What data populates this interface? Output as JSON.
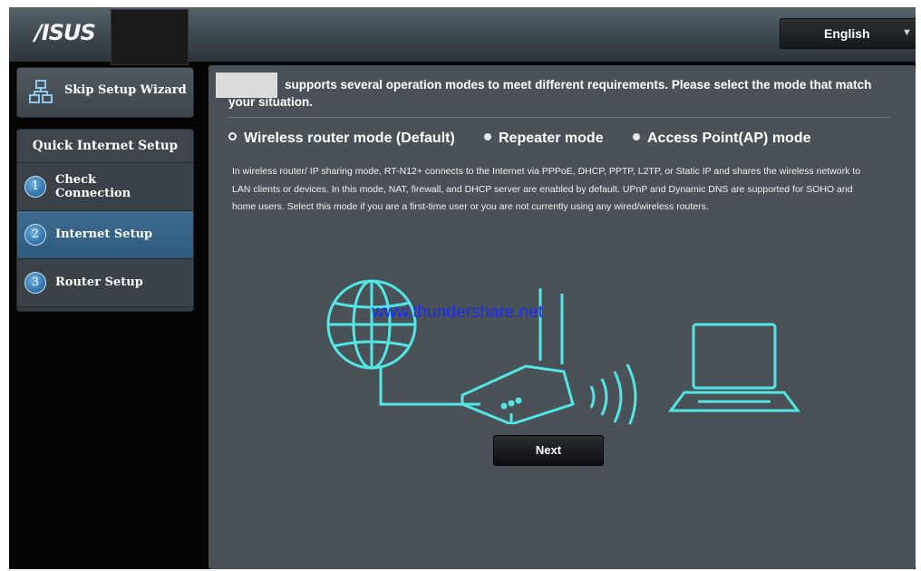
{
  "header": {
    "logo": "/ISUS",
    "language": {
      "selected": "English",
      "icon": "chevron-down-icon"
    }
  },
  "sidebar": {
    "skip_wizard": {
      "label": "Skip Setup Wizard",
      "icon": "network-icon"
    },
    "quick_setup_title": "Quick Internet Setup",
    "steps": [
      {
        "number": "1",
        "label": "Check Connection",
        "active": false
      },
      {
        "number": "2",
        "label": "Internet Setup",
        "active": true
      },
      {
        "number": "3",
        "label": "Router Setup",
        "active": false
      }
    ]
  },
  "main": {
    "intro": "supports several operation modes to meet different requirements. Please select the mode that match your situation.",
    "modes": [
      {
        "label": "Wireless router mode (Default)",
        "selected": true
      },
      {
        "label": "Repeater mode",
        "selected": false
      },
      {
        "label": "Access Point(AP) mode",
        "selected": false
      }
    ],
    "description": "In wireless router/ IP sharing mode, RT-N12+ connects to the Internet via PPPoE, DHCP, PPTP, L2TP, or Static IP and shares the wireless network to LAN clients or devices. In this mode, NAT, firewall, and DHCP server are enabled by default. UPnP and Dynamic DNS are supported for SOHO and home users. Select this mode if you are a first-time user or you are not currently using any wired/wireless routers.",
    "watermark": "www.thundershare.net",
    "next_label": "Next"
  },
  "colors": {
    "glow": "#52e6e6",
    "panel": "#4a5257",
    "active_step": "#3e6c91"
  }
}
